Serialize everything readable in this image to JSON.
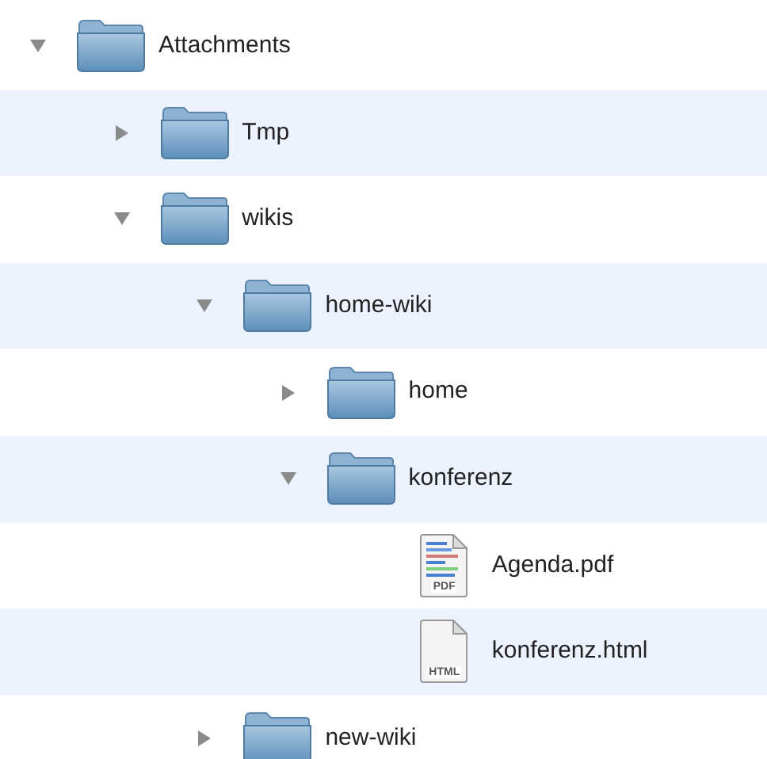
{
  "tree": [
    {
      "kind": "folder",
      "name": "Attachments",
      "expanded": true,
      "children": [
        {
          "kind": "folder",
          "name": "Tmp",
          "expanded": false
        },
        {
          "kind": "folder",
          "name": "wikis",
          "expanded": true,
          "children": [
            {
              "kind": "folder",
              "name": "home-wiki",
              "expanded": true,
              "children": [
                {
                  "kind": "folder",
                  "name": "home",
                  "expanded": false
                },
                {
                  "kind": "folder",
                  "name": "konferenz",
                  "expanded": true,
                  "children": [
                    {
                      "kind": "pdf",
                      "name": "Agenda.pdf",
                      "icon_label": "PDF"
                    },
                    {
                      "kind": "html",
                      "name": "konferenz.html",
                      "icon_label": "HTML"
                    }
                  ]
                }
              ]
            },
            {
              "kind": "folder",
              "name": "new-wiki",
              "expanded": false
            }
          ]
        }
      ]
    }
  ]
}
